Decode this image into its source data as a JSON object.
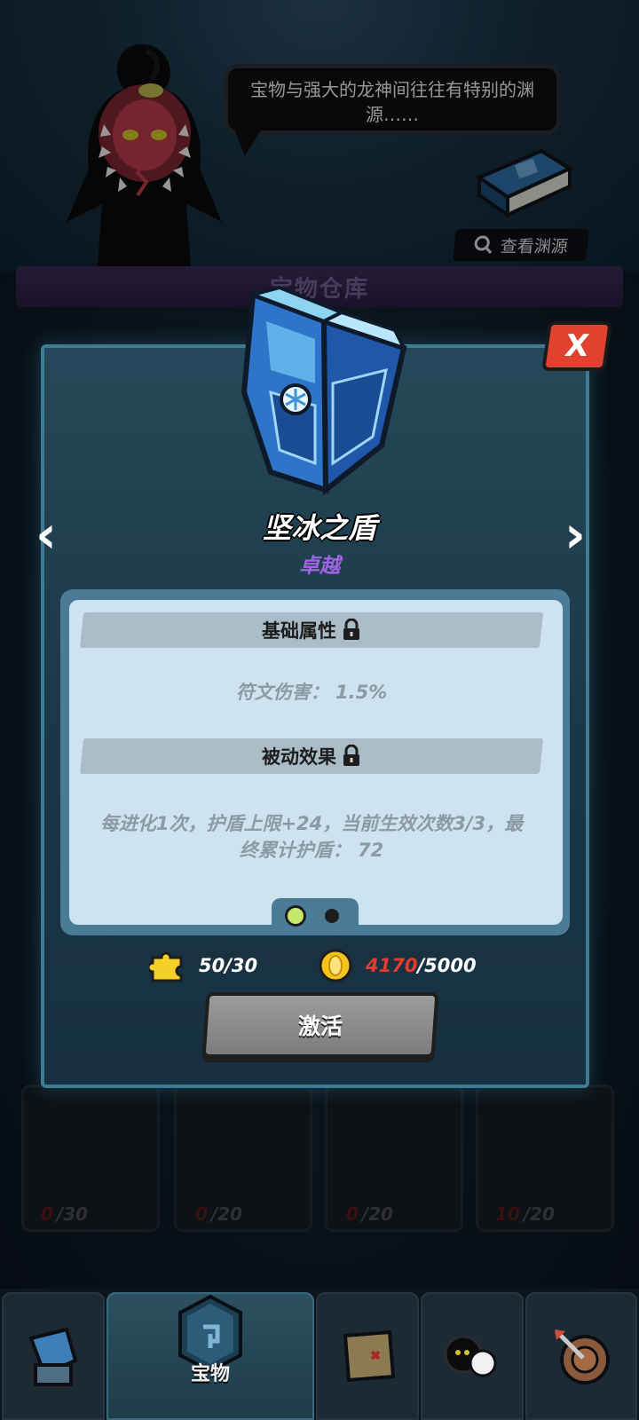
{
  "header": {
    "speech_bubble": "宝物与强大的龙神间往往有特别的渊源……",
    "view_origin_label": "查看渊源",
    "warehouse_title": "宝物仓库"
  },
  "item": {
    "name": "坚冰之盾",
    "rarity": "卓越",
    "base_section_title": "基础属性",
    "base_attribute": "符文伤害： 1.5%",
    "passive_section_title": "被动效果",
    "passive_effect_line1": "每进化1次，护盾上限+24，当前生效次数3/3，最",
    "passive_effect_line2": "终累计护盾： 72",
    "page_count": 2,
    "active_page": 1
  },
  "cost": {
    "fragments": "50/30",
    "coins_have": "4170",
    "coins_need": "/5000"
  },
  "buttons": {
    "close": "X",
    "prev": "‹",
    "next": "›",
    "activate": "激活"
  },
  "background_cards": [
    {
      "have": "0",
      "need": "/30"
    },
    {
      "have": "0",
      "need": "/20"
    },
    {
      "have": "0",
      "need": "/20"
    },
    {
      "have": "10",
      "need": "/20"
    }
  ],
  "bottom_nav": {
    "active_label": "宝物",
    "items": [
      "castle-icon",
      "treasure-icon",
      "map-icon",
      "characters-icon",
      "target-icon"
    ]
  },
  "colors": {
    "rarity": "#a264e6",
    "close_button": "#e0422f",
    "coin_deficit": "#e63b2f",
    "active_dot": "#c6e86a"
  }
}
